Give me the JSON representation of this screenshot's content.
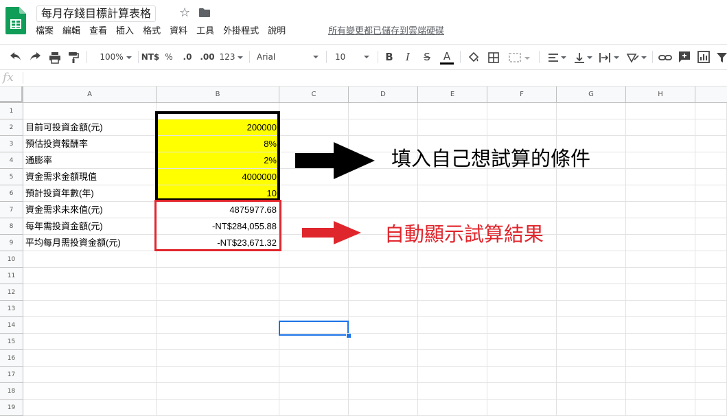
{
  "app": {
    "doc_title": "每月存錢目標計算表格",
    "star_icon": "star-icon",
    "folder_icon": "folder-icon",
    "menu": [
      "檔案",
      "編輯",
      "查看",
      "插入",
      "格式",
      "資料",
      "工具",
      "外掛程式",
      "說明"
    ],
    "save_status": "所有變更都已儲存到雲端硬碟"
  },
  "toolbar": {
    "zoom": "100%",
    "currency": "NT$",
    "percent": "%",
    "dec_decrease": ".0",
    "dec_increase": ".00",
    "more_formats": "123",
    "font": "Arial",
    "font_size": "10",
    "bold": "B",
    "italic": "I",
    "strike": "S",
    "text_color": "A"
  },
  "formula_bar": {
    "fx": "fx",
    "value": ""
  },
  "columns": [
    "A",
    "B",
    "C",
    "D",
    "E",
    "F",
    "G",
    "H"
  ],
  "rows": [
    "1",
    "2",
    "3",
    "4",
    "5",
    "6",
    "7",
    "8",
    "9",
    "10",
    "11",
    "12",
    "13",
    "14",
    "15",
    "16",
    "17",
    "18",
    "19"
  ],
  "sheet": {
    "inputs": [
      {
        "row": "2",
        "label": "目前可投資金額(元)",
        "value": "200000"
      },
      {
        "row": "3",
        "label": "預估投資報酬率",
        "value": "8%"
      },
      {
        "row": "4",
        "label": "通膨率",
        "value": "2%"
      },
      {
        "row": "5",
        "label": "資金需求金額現值",
        "value": "4000000"
      },
      {
        "row": "6",
        "label": "預計投資年數(年)",
        "value": "10"
      }
    ],
    "results": [
      {
        "row": "7",
        "label": "資金需求未來值(元)",
        "value": "4875977.68"
      },
      {
        "row": "8",
        "label": "每年需投資金額(元)",
        "value": "-NT$284,055.88"
      },
      {
        "row": "9",
        "label": "平均每月需投資金額(元)",
        "value": "-NT$23,671.32"
      }
    ]
  },
  "annotations": {
    "input_note": "填入自己想試算的條件",
    "result_note": "自動顯示試算結果"
  },
  "colors": {
    "input_fill": "#ffff00",
    "input_border": "#000000",
    "result_border": "#e0262d",
    "result_note": "#e0262d",
    "selection": "#1a73e8"
  }
}
